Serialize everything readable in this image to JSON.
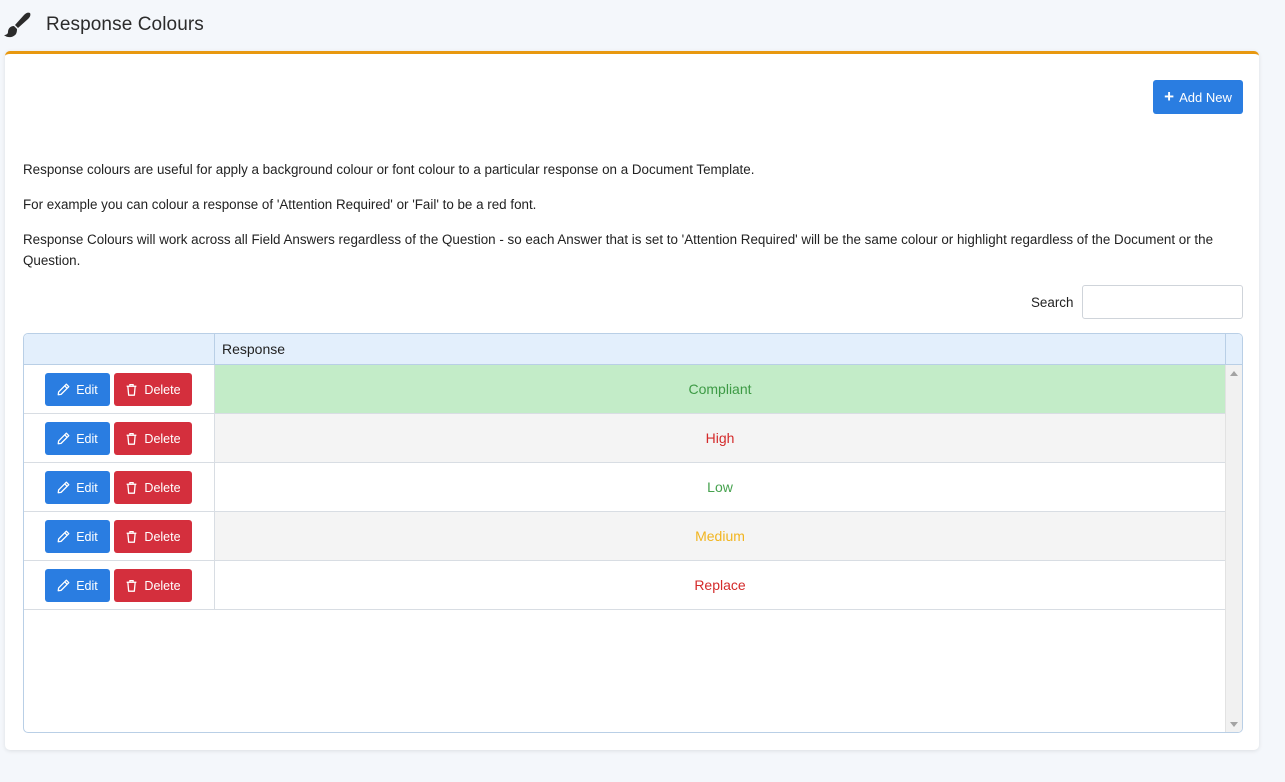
{
  "header": {
    "title": "Response Colours",
    "icon": "paintbrush-icon"
  },
  "toolbar": {
    "add_label": "Add New",
    "add_icon": "plus-icon"
  },
  "description": {
    "p1": "Response colours are useful for apply a background colour or font colour to a particular response on a Document Template.",
    "p2": "For example you can colour a response of 'Attention Required' or 'Fail' to be a red font.",
    "p3": "Response Colours will work across all Field Answers regardless of the Question - so each Answer that is set to 'Attention Required' will be the same colour or highlight regardless of the Document or the Question."
  },
  "search": {
    "label": "Search",
    "value": "",
    "placeholder": ""
  },
  "grid": {
    "columns": [
      "",
      "Response"
    ],
    "edit_label": "Edit",
    "delete_label": "Delete",
    "rows": [
      {
        "response": "Compliant",
        "color": "#3d9a45",
        "background": "#c3ecc8"
      },
      {
        "response": "High",
        "color": "#d42a2a",
        "background": "#f4f4f4"
      },
      {
        "response": "Low",
        "color": "#46a24e",
        "background": "#ffffff"
      },
      {
        "response": "Medium",
        "color": "#f2b51f",
        "background": "#f4f4f4"
      },
      {
        "response": "Replace",
        "color": "#d42a2a",
        "background": "#ffffff"
      }
    ]
  },
  "colors": {
    "accent": "#e8980f",
    "primary": "#2a7de1",
    "danger": "#d42f3d"
  }
}
